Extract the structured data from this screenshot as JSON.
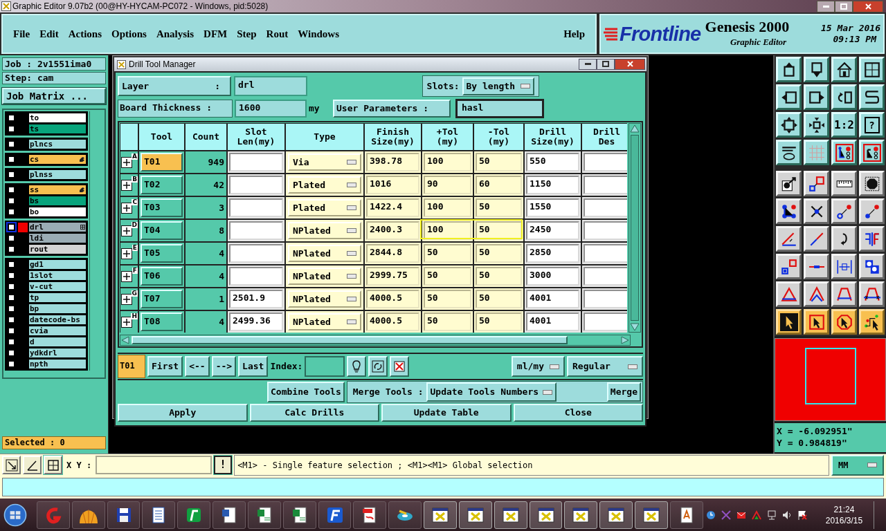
{
  "window": {
    "title": "Graphic Editor 9.07b2 (00@HY-HYCAM-PC072 - Windows, pid:5028)"
  },
  "menu": [
    "File",
    "Edit",
    "Actions",
    "Options",
    "Analysis",
    "DFM",
    "Step",
    "Rout",
    "Windows"
  ],
  "help": "Help",
  "brand": {
    "logo": "Frontline",
    "product": "Genesis 2000",
    "subtitle": "Graphic Editor",
    "date": "15 Mar 2016",
    "time": "09:13 PM"
  },
  "job_panel": {
    "job": "Job : 2v1551ima0",
    "step": "Step: cam",
    "matrix_button": "Job Matrix ...",
    "selected": "Selected : 0",
    "layer_groups": [
      [
        {
          "name": "to",
          "color": "#ffffff",
          "work": false,
          "affected": false,
          "hand": false,
          "grid": false
        },
        {
          "name": "ts",
          "color": "#08a47c",
          "work": false,
          "affected": false,
          "hand": false,
          "grid": false
        }
      ],
      [
        {
          "name": "plncs",
          "color": "#9ddcdc",
          "work": false,
          "affected": false,
          "hand": false,
          "grid": false
        }
      ],
      [
        {
          "name": "cs",
          "color": "#f8c050",
          "work": false,
          "affected": false,
          "hand": true,
          "grid": false
        }
      ],
      [
        {
          "name": "plnss",
          "color": "#9ddcdc",
          "work": false,
          "affected": false,
          "hand": false,
          "grid": false
        }
      ],
      [
        {
          "name": "ss",
          "color": "#f8c050",
          "work": false,
          "affected": false,
          "hand": true,
          "grid": false
        },
        {
          "name": "bs",
          "color": "#08a47c",
          "work": false,
          "affected": false,
          "hand": false,
          "grid": false
        },
        {
          "name": "bo",
          "color": "#ffffff",
          "work": false,
          "affected": false,
          "hand": false,
          "grid": false
        }
      ],
      [
        {
          "name": "drl",
          "color": "#9aacb4",
          "work": true,
          "affected": true,
          "hand": false,
          "grid": true
        },
        {
          "name": "ldi",
          "color": "#9aacb4",
          "work": false,
          "affected": false,
          "hand": false,
          "grid": false
        },
        {
          "name": "rout",
          "color": "#d4d4d4",
          "work": false,
          "affected": false,
          "hand": false,
          "grid": false
        }
      ],
      [
        {
          "name": "gd1",
          "color": "#9ddcdc",
          "work": false,
          "affected": false,
          "hand": false,
          "grid": false
        },
        {
          "name": "1slot",
          "color": "#9ddcdc",
          "work": false,
          "affected": false,
          "hand": false,
          "grid": false
        },
        {
          "name": "v-cut",
          "color": "#9ddcdc",
          "work": false,
          "affected": false,
          "hand": false,
          "grid": false
        },
        {
          "name": "tp",
          "color": "#9ddcdc",
          "work": false,
          "affected": false,
          "hand": false,
          "grid": false
        },
        {
          "name": "bp",
          "color": "#9ddcdc",
          "work": false,
          "affected": false,
          "hand": false,
          "grid": false
        },
        {
          "name": "datecode-bs",
          "color": "#9ddcdc",
          "work": false,
          "affected": false,
          "hand": false,
          "grid": false
        },
        {
          "name": "cvia",
          "color": "#9ddcdc",
          "work": false,
          "affected": false,
          "hand": false,
          "grid": false
        },
        {
          "name": "d",
          "color": "#9ddcdc",
          "work": false,
          "affected": false,
          "hand": false,
          "grid": false
        },
        {
          "name": "ydkdrl",
          "color": "#9ddcdc",
          "work": false,
          "affected": false,
          "hand": false,
          "grid": false
        },
        {
          "name": "npth",
          "color": "#9ddcdc",
          "work": false,
          "affected": false,
          "hand": false,
          "grid": false
        }
      ]
    ]
  },
  "dialog": {
    "title": "Drill Tool Manager",
    "layer_label": "Layer",
    "layer_colon": ":",
    "layer": "drl",
    "slots_label": "Slots:",
    "slots": "By length",
    "thickness_label": "Board Thickness :",
    "thickness": "1600",
    "thickness_unit": "my",
    "user_params": "User Parameters :",
    "user_params_value": "hasl",
    "columns": [
      [
        "Tool"
      ],
      [
        "Count"
      ],
      [
        "Slot",
        "Len(my)"
      ],
      [
        "Type"
      ],
      [
        "Finish",
        "Size(my)"
      ],
      [
        "+Tol",
        "(my)"
      ],
      [
        "-Tol",
        "(my)"
      ],
      [
        "Drill",
        "Size(my)"
      ],
      [
        "Drill",
        "Des"
      ]
    ],
    "rows": [
      {
        "mark": "A",
        "tool": "T01",
        "selected": true,
        "count": "949",
        "type": "Via",
        "finish": "398.78",
        "plus_tol": "100",
        "minus_tol": "50",
        "drill": "550",
        "highlighted": false
      },
      {
        "mark": "B",
        "tool": "T02",
        "selected": false,
        "count": "42",
        "type": "Plated",
        "finish": "1016",
        "plus_tol": "90",
        "minus_tol": "60",
        "drill": "1150",
        "highlighted": false
      },
      {
        "mark": "C",
        "tool": "T03",
        "selected": false,
        "count": "3",
        "type": "Plated",
        "finish": "1422.4",
        "plus_tol": "100",
        "minus_tol": "50",
        "drill": "1550",
        "highlighted": false
      },
      {
        "mark": "D",
        "tool": "T04",
        "selected": false,
        "count": "8",
        "type": "NPlated",
        "finish": "2400.3",
        "plus_tol": "100",
        "minus_tol": "50",
        "drill": "2450",
        "highlighted": true
      },
      {
        "mark": "E",
        "tool": "T05",
        "selected": false,
        "count": "4",
        "type": "NPlated",
        "finish": "2844.8",
        "plus_tol": "50",
        "minus_tol": "50",
        "drill": "2850",
        "highlighted": false
      },
      {
        "mark": "F",
        "tool": "T06",
        "selected": false,
        "count": "4",
        "type": "NPlated",
        "finish": "2999.75",
        "plus_tol": "50",
        "minus_tol": "50",
        "drill": "3000",
        "highlighted": false
      },
      {
        "mark": "G",
        "tool": "T07",
        "selected": false,
        "count": "1",
        "slot_len": "2501.9",
        "type": "NPlated",
        "finish": "4000.5",
        "plus_tol": "50",
        "minus_tol": "50",
        "drill": "4001",
        "highlighted": false
      },
      {
        "mark": "H",
        "tool": "T08",
        "selected": false,
        "count": "4",
        "slot_len": "2499.36",
        "type": "NPlated",
        "finish": "4000.5",
        "plus_tol": "50",
        "minus_tol": "50",
        "drill": "4001",
        "highlighted": false
      }
    ],
    "current_tool": "T01",
    "nav_buttons": [
      "First",
      "<--",
      "-->",
      "Last"
    ],
    "index_label": "Index:",
    "units": "ml/my",
    "mode": "Regular",
    "combine": "Combine Tools",
    "merge_label": "Merge Tools :",
    "merge_mode": "Update Tools Numbers",
    "merge": "Merge",
    "actions": [
      "Apply",
      "Calc Drills",
      "Update Table",
      "Close"
    ]
  },
  "toolbar": {
    "scale": "1:2",
    "help": "?"
  },
  "coords": {
    "x": "X = -6.092951\"",
    "y": "Y = 0.984819\""
  },
  "status": {
    "xy_label": "X Y :",
    "alert": "!",
    "message": "<M1> - Single feature selection ; <M1><M1> Global selection",
    "units": "MM"
  },
  "taskbar": {
    "time": "21:24",
    "date": "2016/3/15"
  }
}
